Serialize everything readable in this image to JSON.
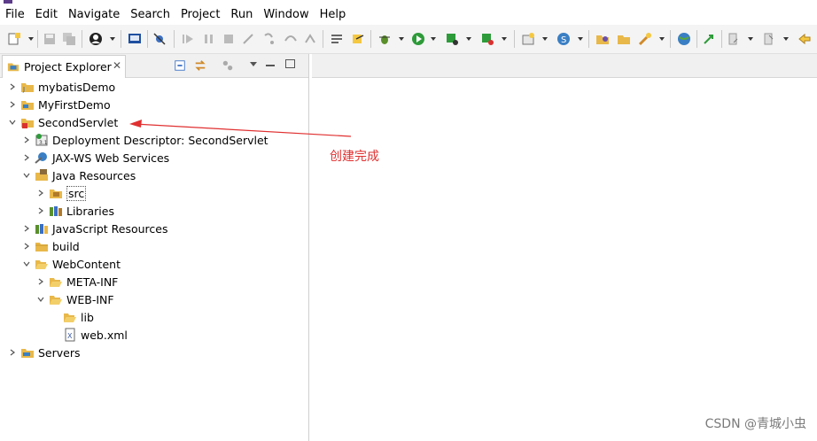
{
  "menu": [
    "File",
    "Edit",
    "Navigate",
    "Search",
    "Project",
    "Run",
    "Window",
    "Help"
  ],
  "explorer": {
    "tab_label": "Project Explorer",
    "close_glyph": "✕"
  },
  "tree": [
    {
      "label": "mybatisDemo",
      "expanded": false,
      "icon": "project-icon"
    },
    {
      "label": "MyFirstDemo",
      "expanded": false,
      "icon": "project-icon"
    },
    {
      "label": "SecondServlet",
      "expanded": true,
      "icon": "web-project-icon"
    },
    {
      "label": "Deployment Descriptor: SecondServlet",
      "expanded": false,
      "icon": "descriptor-icon"
    },
    {
      "label": "JAX-WS Web Services",
      "expanded": false,
      "icon": "webservice-icon"
    },
    {
      "label": "Java Resources",
      "expanded": true,
      "icon": "java-resources-icon"
    },
    {
      "label": "src",
      "expanded": false,
      "icon": "package-folder-icon"
    },
    {
      "label": "Libraries",
      "expanded": false,
      "icon": "library-icon"
    },
    {
      "label": "JavaScript Resources",
      "expanded": false,
      "icon": "js-resources-icon"
    },
    {
      "label": "build",
      "expanded": false,
      "icon": "folder-icon"
    },
    {
      "label": "WebContent",
      "expanded": true,
      "icon": "folder-open-icon"
    },
    {
      "label": "META-INF",
      "expanded": false,
      "icon": "folder-icon"
    },
    {
      "label": "WEB-INF",
      "expanded": true,
      "icon": "folder-open-icon"
    },
    {
      "label": "lib",
      "expanded": null,
      "icon": "folder-icon"
    },
    {
      "label": "web.xml",
      "expanded": null,
      "icon": "xml-file-icon"
    },
    {
      "label": "Servers",
      "expanded": false,
      "icon": "project-icon"
    }
  ],
  "annotation": {
    "text": "创建完成",
    "color": "#e03030"
  },
  "watermark": "CSDN @青城小虫",
  "colors": {
    "toolbar_bg": "#f4f4f4",
    "accent_red": "#e03030"
  }
}
